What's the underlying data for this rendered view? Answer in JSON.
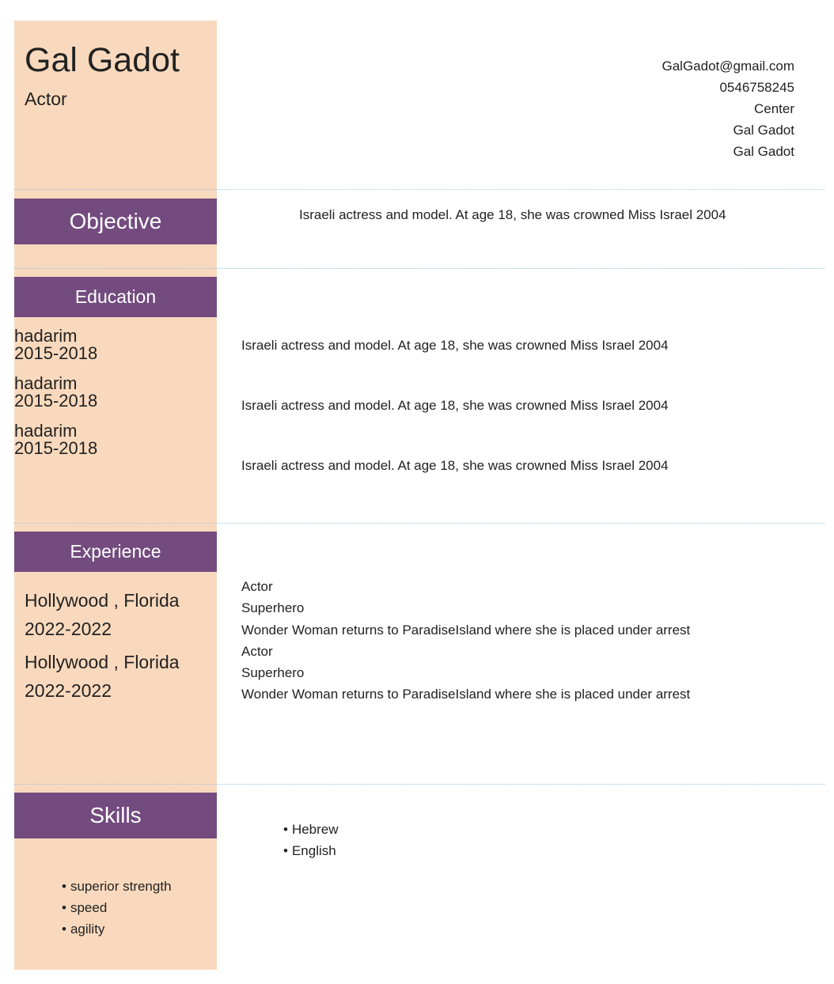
{
  "header": {
    "name": "Gal Gadot",
    "role": "Actor",
    "contact": [
      "GalGadot@gmail.com",
      "0546758245",
      "Center",
      "Gal Gadot",
      "Gal Gadot"
    ]
  },
  "objective": {
    "title": "Objective",
    "text": "Israeli actress and model. At age 18, she was crowned Miss Israel 2004"
  },
  "education": {
    "title": "Education",
    "items": [
      {
        "school": "hadarim",
        "years": "2015-2018",
        "description": "Israeli actress and model. At age 18, she was crowned Miss Israel 2004"
      },
      {
        "school": "hadarim",
        "years": "2015-2018",
        "description": "Israeli actress and model. At age 18, she was crowned Miss Israel 2004"
      },
      {
        "school": "hadarim",
        "years": "2015-2018",
        "description": "Israeli actress and model. At age 18, she was crowned Miss Israel 2004"
      }
    ]
  },
  "experience": {
    "title": "Experience",
    "items": [
      {
        "location": "Hollywood , Florida",
        "years": "2022-2022",
        "role": "Actor",
        "position": "Superhero",
        "description": "Wonder Woman returns to ParadiseIsland where she is placed under arrest"
      },
      {
        "location": "Hollywood , Florida",
        "years": "2022-2022",
        "role": "Actor",
        "position": "Superhero",
        "description": "Wonder Woman returns to ParadiseIsland where she is placed under arrest"
      }
    ]
  },
  "skills": {
    "title": "Skills",
    "left": [
      "superior strength",
      "speed",
      "agility"
    ],
    "right": [
      "Hebrew",
      "English"
    ]
  },
  "colors": {
    "sidebar": "#f9d9bd",
    "section_header": "#734b7f",
    "divider": "#9cc3e0"
  }
}
